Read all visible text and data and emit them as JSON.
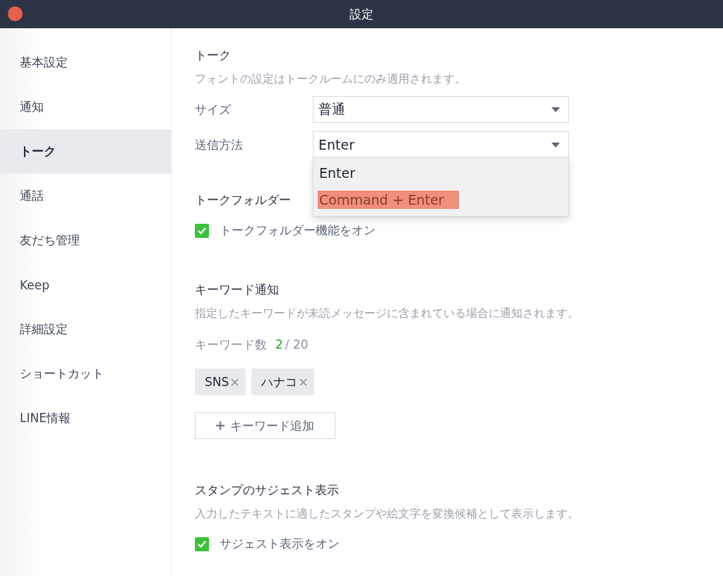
{
  "window": {
    "title": "設定"
  },
  "sidebar": {
    "items": [
      {
        "label": "基本設定",
        "selected": false
      },
      {
        "label": "通知",
        "selected": false
      },
      {
        "label": "トーク",
        "selected": true
      },
      {
        "label": "通話",
        "selected": false
      },
      {
        "label": "友だち管理",
        "selected": false
      },
      {
        "label": "Keep",
        "selected": false
      },
      {
        "label": "詳細設定",
        "selected": false
      },
      {
        "label": "ショートカット",
        "selected": false
      },
      {
        "label": "LINE情報",
        "selected": false
      }
    ]
  },
  "talk": {
    "heading": "トーク",
    "description": "フォントの設定はトークルームにのみ適用されます。",
    "fields": [
      {
        "label": "サイズ",
        "value": "普通",
        "expanded": false
      },
      {
        "label": "送信方法",
        "value": "Enter",
        "expanded": true,
        "options": [
          {
            "label": "Enter",
            "highlighted": false
          },
          {
            "label": "Command + Enter",
            "highlighted": true
          }
        ]
      }
    ]
  },
  "talk_folder": {
    "heading": "トークフォルダー",
    "checkbox": {
      "label": "トークフォルダー機能をオン",
      "checked": true
    }
  },
  "keyword": {
    "heading": "キーワード通知",
    "description": "指定したキーワードが未読メッセージに含まれている場合に通知されます。",
    "count_label": "キーワード数",
    "count": "2",
    "limit": "/ 20",
    "tags": [
      {
        "label": "SNS"
      },
      {
        "label": "ハナコ"
      }
    ],
    "add_button": "キーワード追加"
  },
  "sticker": {
    "heading": "スタンプのサジェスト表示",
    "description": "入力したテキストに適したスタンプや絵文字を変換候補として表示します。",
    "checkbox": {
      "label": "サジェスト表示をオン",
      "checked": true
    }
  }
}
